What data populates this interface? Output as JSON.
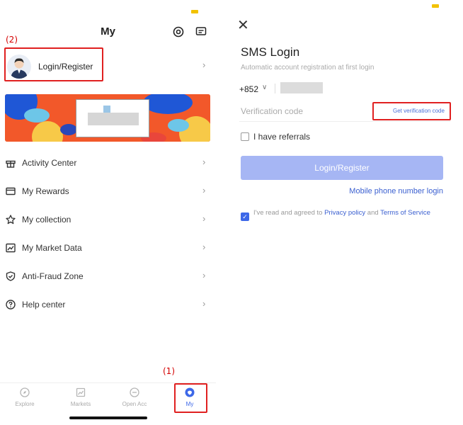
{
  "left": {
    "title": "My",
    "annotations": {
      "login": "(2)",
      "tab": "(1)"
    },
    "login_label": "Login/Register",
    "menu": [
      {
        "label": "Activity Center",
        "icon": "gift-icon"
      },
      {
        "label": "My Rewards",
        "icon": "card-icon"
      },
      {
        "label": "My collection",
        "icon": "star-icon"
      },
      {
        "label": "My Market Data",
        "icon": "chart-icon"
      },
      {
        "label": "Anti-Fraud Zone",
        "icon": "shield-icon"
      },
      {
        "label": "Help center",
        "icon": "question-icon"
      }
    ],
    "tabs": [
      {
        "label": "Explore",
        "icon": "explore-icon"
      },
      {
        "label": "Markets",
        "icon": "markets-icon"
      },
      {
        "label": "Open Acc",
        "icon": "open-account-icon"
      },
      {
        "label": "My",
        "icon": "my-icon"
      }
    ]
  },
  "right": {
    "title": "SMS Login",
    "subtitle": "Automatic account registration at first login",
    "country_code": "+852",
    "verification_placeholder": "Verification code",
    "get_code": "Get verification code",
    "referrals": "I have referrals",
    "submit": "Login/Register",
    "mobile_login": "Mobile phone number login",
    "agreement": {
      "prefix": "I've read and agreed to ",
      "privacy": "Privacy policy",
      "and": " and ",
      "terms": "Terms of Service"
    }
  },
  "colors": {
    "accent": "#3d68e8",
    "button_disabled": "#a6b6f4",
    "annotation": "#e02020",
    "status_dot": "#f2c200"
  }
}
